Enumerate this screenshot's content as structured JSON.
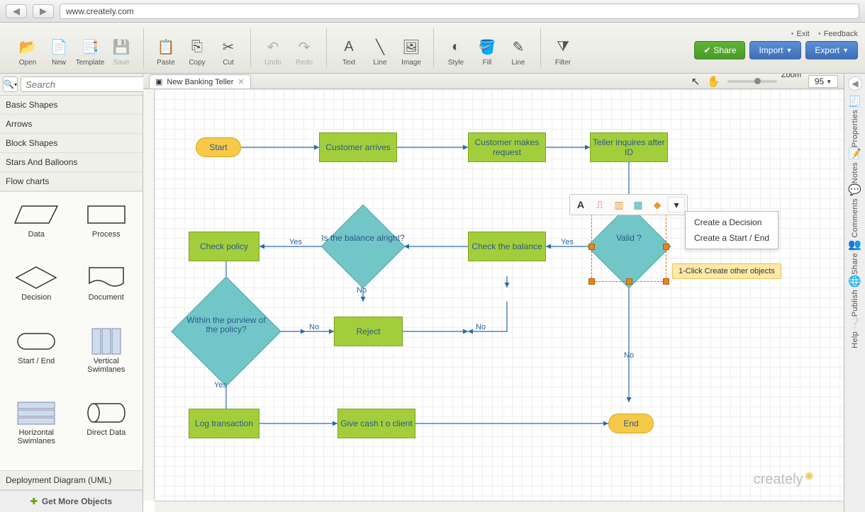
{
  "url": "www.creately.com",
  "toolbar": {
    "groups": [
      [
        {
          "id": "open",
          "label": "Open",
          "icon": "📂"
        },
        {
          "id": "new",
          "label": "New",
          "icon": "📄"
        },
        {
          "id": "template",
          "label": "Template",
          "icon": "📑"
        },
        {
          "id": "save",
          "label": "Save",
          "icon": "💾",
          "disabled": true
        }
      ],
      [
        {
          "id": "paste",
          "label": "Paste",
          "icon": "📋"
        },
        {
          "id": "copy",
          "label": "Copy",
          "icon": "⎘"
        },
        {
          "id": "cut",
          "label": "Cut",
          "icon": "✂"
        }
      ],
      [
        {
          "id": "undo",
          "label": "Undo",
          "icon": "↶",
          "disabled": true
        },
        {
          "id": "redo",
          "label": "Redo",
          "icon": "↷",
          "disabled": true
        }
      ],
      [
        {
          "id": "text",
          "label": "Text",
          "icon": "A"
        },
        {
          "id": "line",
          "label": "Line",
          "icon": "╲"
        },
        {
          "id": "image",
          "label": "Image",
          "icon": "🖼"
        }
      ],
      [
        {
          "id": "style",
          "label": "Style",
          "icon": "◐"
        },
        {
          "id": "fill",
          "label": "Fill",
          "icon": "🪣"
        },
        {
          "id": "line2",
          "label": "Line",
          "icon": "✎"
        }
      ],
      [
        {
          "id": "filter",
          "label": "Filter",
          "icon": "⧩"
        }
      ]
    ],
    "links": {
      "exit": "Exit",
      "feedback": "Feedback"
    },
    "actions": {
      "share": "Share",
      "import": "Import",
      "export": "Export"
    }
  },
  "sidebar": {
    "search_placeholder": "Search",
    "categories": [
      "Basic Shapes",
      "Arrows",
      "Block Shapes",
      "Stars And Balloons",
      "Flow charts"
    ],
    "palette": [
      {
        "id": "data",
        "label": "Data"
      },
      {
        "id": "process",
        "label": "Process"
      },
      {
        "id": "decision",
        "label": "Decision"
      },
      {
        "id": "document",
        "label": "Document"
      },
      {
        "id": "startend",
        "label": "Start / End"
      },
      {
        "id": "vswim",
        "label": "Vertical Swimlanes"
      },
      {
        "id": "hswim",
        "label": "Horizontal Swimlanes"
      },
      {
        "id": "directdata",
        "label": "Direct Data"
      }
    ],
    "deployment": "Deployment Diagram (UML)",
    "get_more": "Get More Objects"
  },
  "tab": {
    "title": "New Banking Teller"
  },
  "zoom": {
    "label": "Zoom",
    "value": "95"
  },
  "rail": [
    {
      "id": "properties",
      "label": "Properties",
      "icon": "🧾"
    },
    {
      "id": "notes",
      "label": "Notes",
      "icon": "📝"
    },
    {
      "id": "comments",
      "label": "Comments",
      "icon": "💬"
    },
    {
      "id": "share",
      "label": "Share",
      "icon": "👥"
    },
    {
      "id": "publish",
      "label": "Publish",
      "icon": "🌐"
    },
    {
      "id": "help",
      "label": "Help",
      "icon": "❔"
    }
  ],
  "flow": {
    "start": "Start",
    "customer_arrives": "Customer arrives",
    "customer_request": "Customer makes request",
    "teller_id": "Teller inquires after ID",
    "valid": "Valid ?",
    "check_balance": "Check the balance",
    "balance_ok": "Is the balance  alright?",
    "check_policy": "Check policy",
    "within_policy": "Within the purview  of the policy?",
    "reject": "Reject",
    "log_tx": "Log transaction",
    "give_cash": "Give cash t o client",
    "end": "End",
    "yes": "Yes",
    "no": "No"
  },
  "context": {
    "menu": [
      "Create a Decision",
      "Create a Start / End"
    ],
    "hint": "1-Click Create other objects"
  },
  "logo": "creately"
}
